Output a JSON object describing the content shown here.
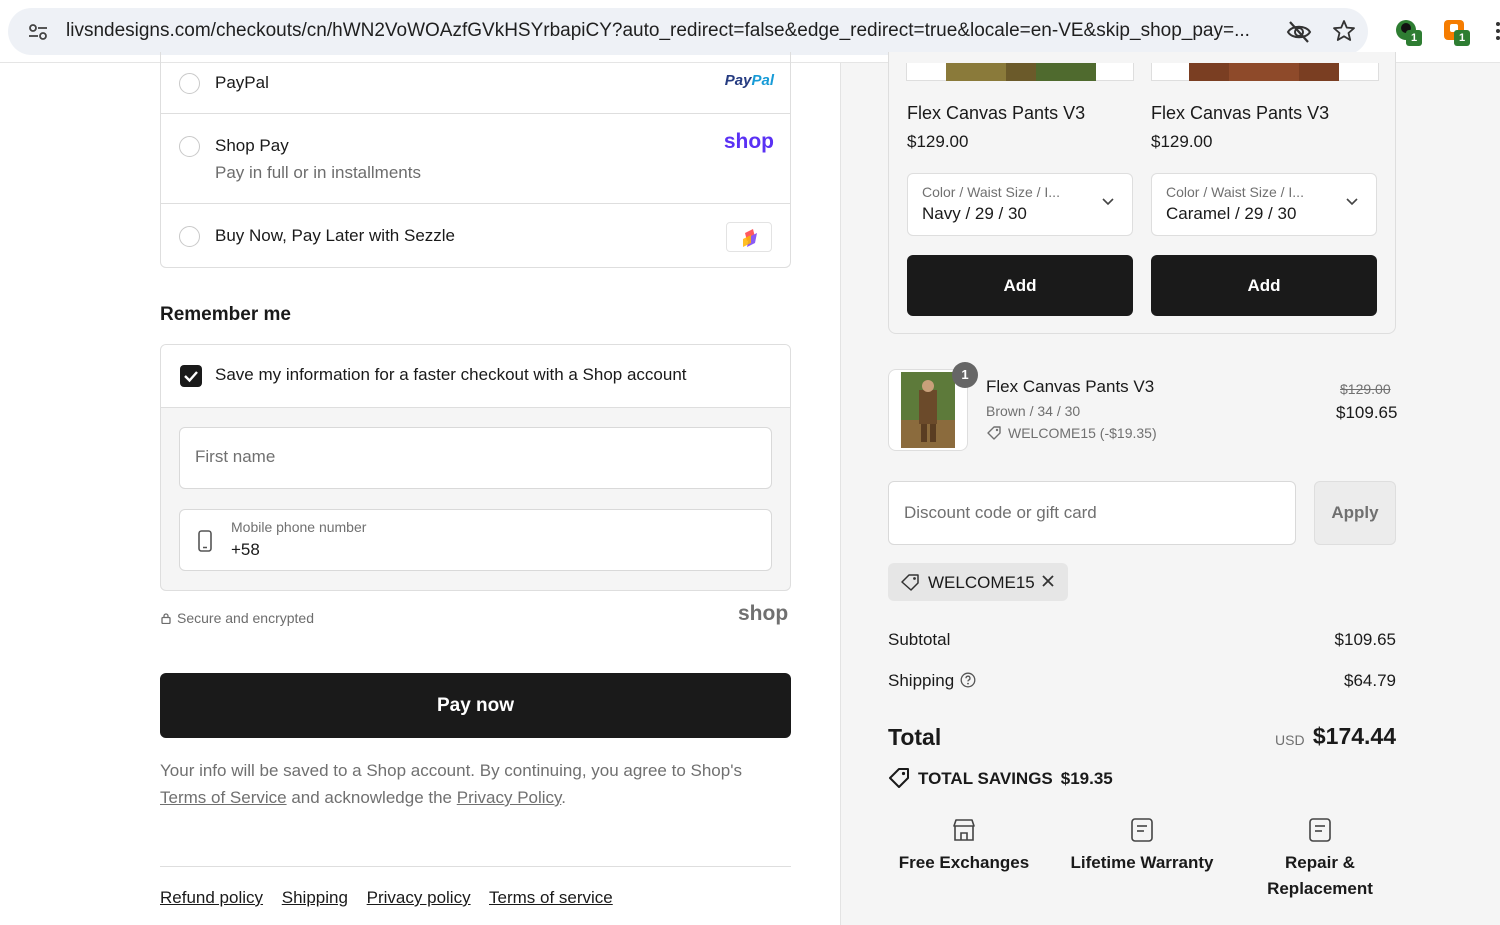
{
  "browser": {
    "url": "livsndesigns.com/checkouts/cn/hWN2VoWOAzfGVkHSYrbapiCY?auto_redirect=false&edge_redirect=true&locale=en-VE&skip_shop_pay=...",
    "extension_badge_1": "1",
    "extension_badge_2": "1"
  },
  "payment": {
    "options": [
      {
        "label": "PayPal",
        "sub": "",
        "logo": "PayPal"
      },
      {
        "label": "Shop Pay",
        "sub": "Pay in full or in installments",
        "logo": "shop"
      },
      {
        "label": "Buy Now, Pay Later with Sezzle",
        "sub": "",
        "logo": "sezzle-logo"
      }
    ],
    "paypal_logo_a": "Pay",
    "paypal_logo_b": "Pal",
    "shop_logo": "shop"
  },
  "remember": {
    "heading": "Remember me",
    "save_label": "Save my information for a faster checkout with a Shop account",
    "save_checked": true,
    "first_name_placeholder": "First name",
    "phone_label": "Mobile phone number",
    "phone_value": "+58",
    "secure_text": "Secure and encrypted",
    "shop_logo": "shop"
  },
  "pay_button": "Pay now",
  "disclaimer": {
    "before": "Your info will be saved to a Shop account. By continuing, you agree to Shop's",
    "terms_link": "Terms of Service",
    "middle": "and acknowledge the",
    "privacy_link": "Privacy Policy",
    "end": "."
  },
  "footer_links": [
    "Refund policy",
    "Shipping",
    "Privacy policy",
    "Terms of service"
  ],
  "upsell": [
    {
      "title": "Flex Canvas Pants V3",
      "price": "$129.00",
      "variant_label": "Color / Waist Size / I...",
      "variant_value": "Navy / 29 / 30",
      "button": "Add"
    },
    {
      "title": "Flex Canvas Pants V3",
      "price": "$129.00",
      "variant_label": "Color / Waist Size / I...",
      "variant_value": "Caramel / 29 / 30",
      "button": "Add"
    }
  ],
  "cart_item": {
    "qty": "1",
    "title": "Flex Canvas Pants V3",
    "variant": "Brown / 34 / 30",
    "discount": "WELCOME15 (-$19.35)",
    "original_price": "$129.00",
    "price": "$109.65"
  },
  "discount": {
    "placeholder": "Discount code or gift card",
    "apply": "Apply",
    "applied_code": "WELCOME15"
  },
  "summary": {
    "subtotal_label": "Subtotal",
    "subtotal_value": "$109.65",
    "shipping_label": "Shipping",
    "shipping_value": "$64.79",
    "total_label": "Total",
    "currency": "USD",
    "total_value": "$174.44",
    "savings_label": "TOTAL SAVINGS",
    "savings_value": "$19.35"
  },
  "badges": [
    {
      "icon": "store-icon",
      "line1": "Free Exchanges",
      "line2": ""
    },
    {
      "icon": "document-icon",
      "line1": "Lifetime Warranty",
      "line2": ""
    },
    {
      "icon": "document-icon",
      "line1": "Repair &",
      "line2": "Replacement"
    }
  ],
  "colors": {
    "primary_button": "#1a1a1a",
    "shop_purple": "#5a31f4",
    "panel_bg": "#f5f5f5"
  }
}
